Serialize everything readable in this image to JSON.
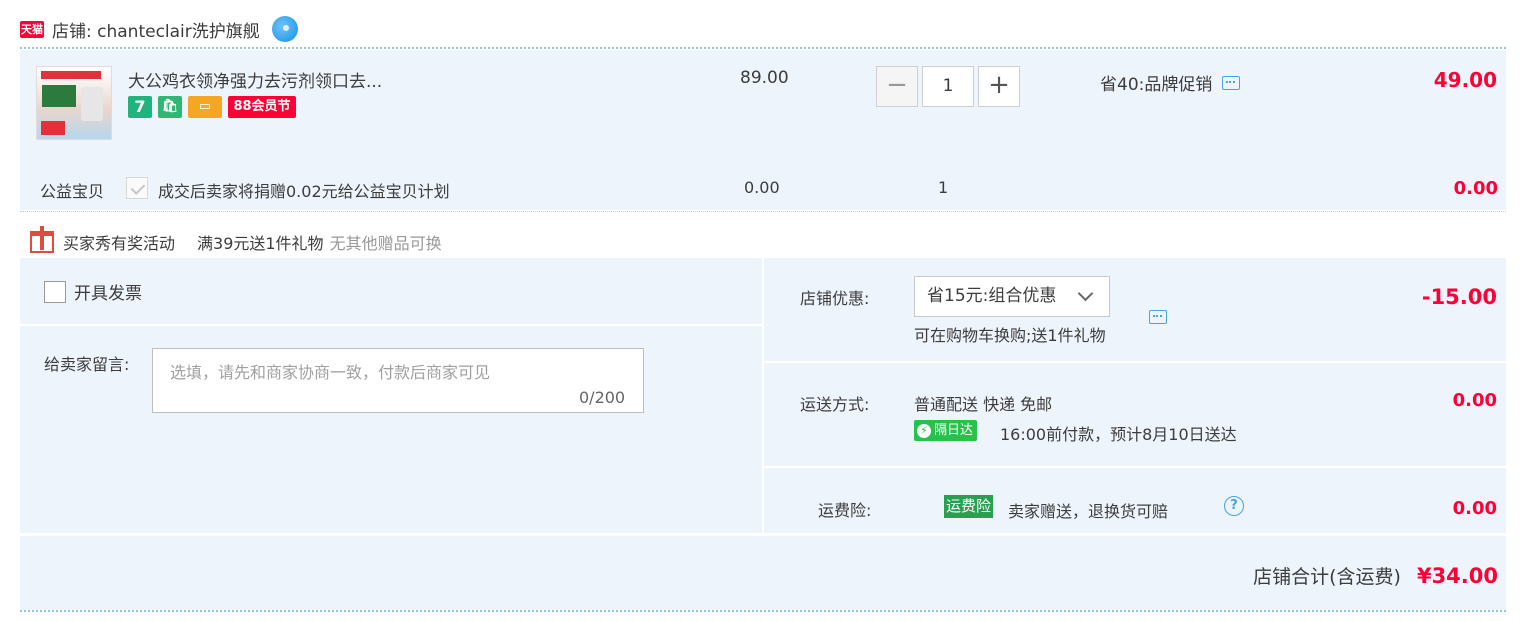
{
  "store": {
    "tmall_logo": "天猫",
    "name_label": "店铺: chanteclair洗护旗舰"
  },
  "item": {
    "title": "大公鸡衣领净强力去污剂领口去...",
    "badges": [
      "7",
      "88会员节"
    ],
    "price": "89.00",
    "quantity": "1",
    "qty_minus": "−",
    "qty_plus": "+",
    "promo": "省40:品牌促销",
    "total": "49.00"
  },
  "charity": {
    "label": "公益宝贝",
    "text": "成交后卖家将捐赠0.02元给公益宝贝计划",
    "price": "0.00",
    "qty": "1",
    "total": "0.00"
  },
  "gift": {
    "name": "买家秀有奖活动",
    "desc": "满39元送1件礼物",
    "note": "无其他赠品可换"
  },
  "invoice": {
    "label": "开具发票",
    "checked": false
  },
  "message": {
    "label": "给卖家留言:",
    "placeholder": "选填，请先和商家协商一致，付款后商家可见",
    "count": "0/200"
  },
  "discount": {
    "label": "店铺优惠:",
    "selected": "省15元:组合优惠",
    "note": "可在购物车换购;送1件礼物",
    "amount": "-15.00"
  },
  "shipping": {
    "label": "运送方式:",
    "method": "普通配送 快递 免邮",
    "badge": "隔日达",
    "badge_icon": "⚡",
    "eta": "16:00前付款，预计8月10日送达",
    "amount": "0.00"
  },
  "insurance": {
    "label": "运费险:",
    "tag": "运费险",
    "text": "卖家赠送，退换货可赔",
    "help": "?",
    "amount": "0.00"
  },
  "summary": {
    "label": "店铺合计(含运费)",
    "total": "¥34.00"
  },
  "colors": {
    "accent_red": "#ff0036",
    "panel_bg": "#eef4fc",
    "green": "#27c24c"
  }
}
